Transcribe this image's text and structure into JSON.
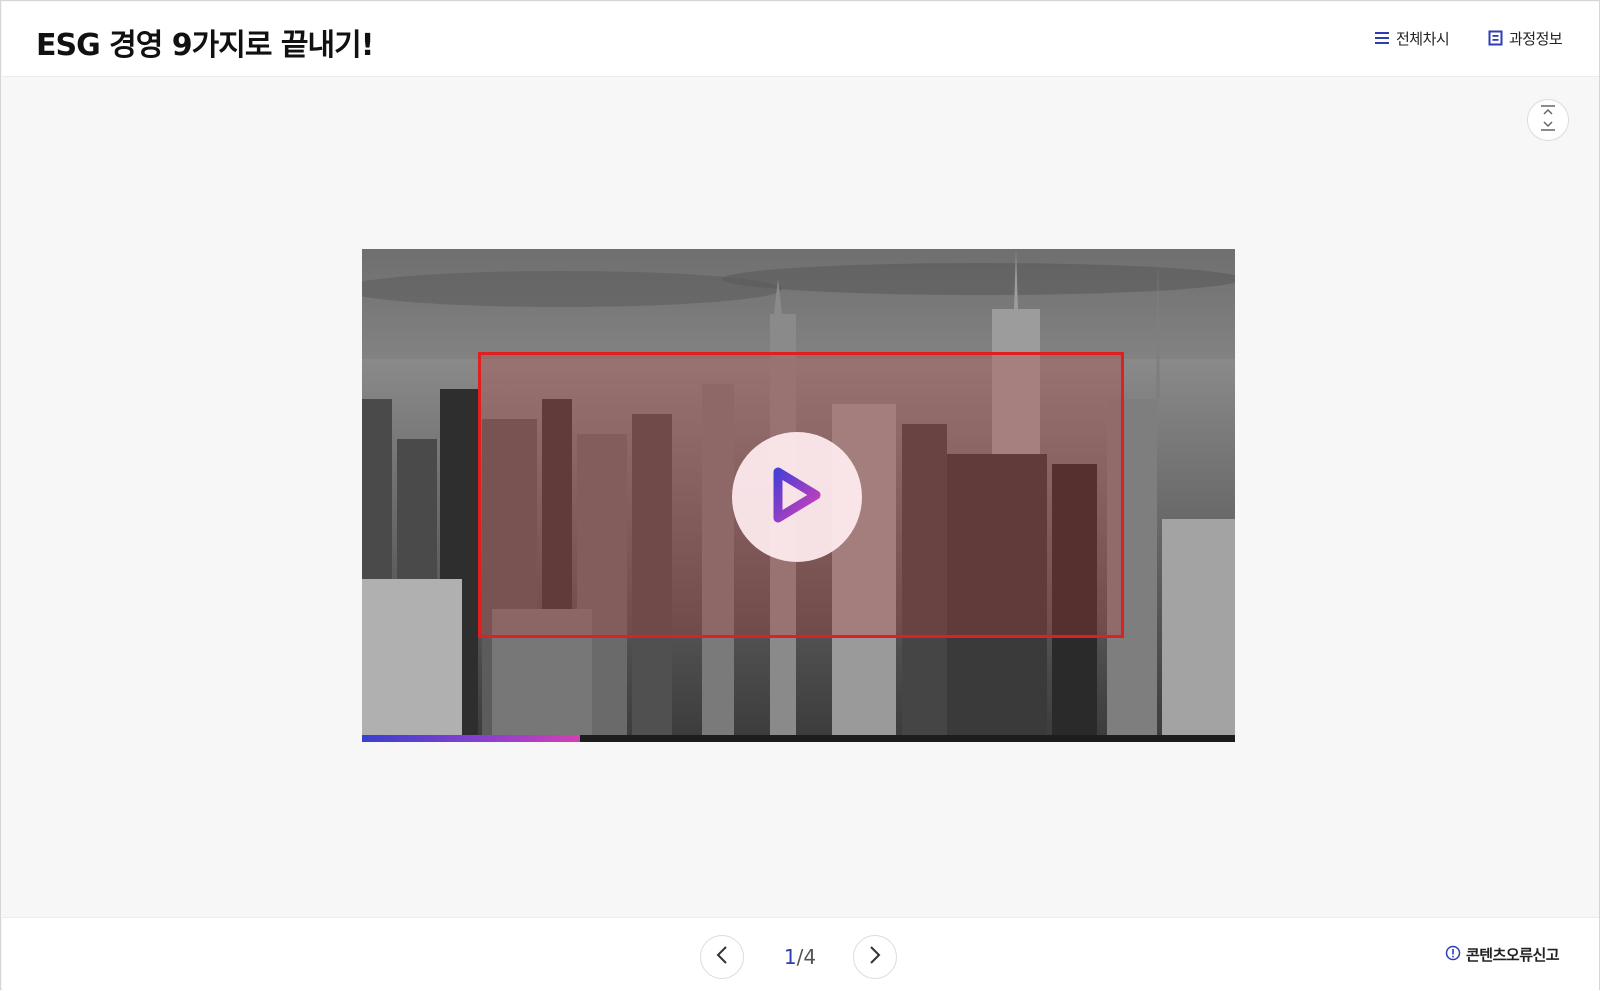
{
  "header": {
    "title": "ESG 경영 9가지로 끝내기!",
    "toc_label": "전체차시",
    "course_info_label": "과정정보"
  },
  "player": {
    "progress_percent": 25,
    "play_icon": "play-icon",
    "colors": {
      "accent": "#2f3db5",
      "progress_start": "#3a3fd0",
      "progress_end": "#d23fb5",
      "highlight_border": "#e02020"
    }
  },
  "footer": {
    "current_page": "1",
    "separator": "/",
    "total_pages": "4",
    "report_label": "콘텐츠오류신고"
  },
  "icons": {
    "toc": "list-icon",
    "course_info": "document-icon",
    "expand": "expand-collapse-icon",
    "prev": "chevron-left-icon",
    "next": "chevron-right-icon",
    "report": "info-circle-icon"
  }
}
